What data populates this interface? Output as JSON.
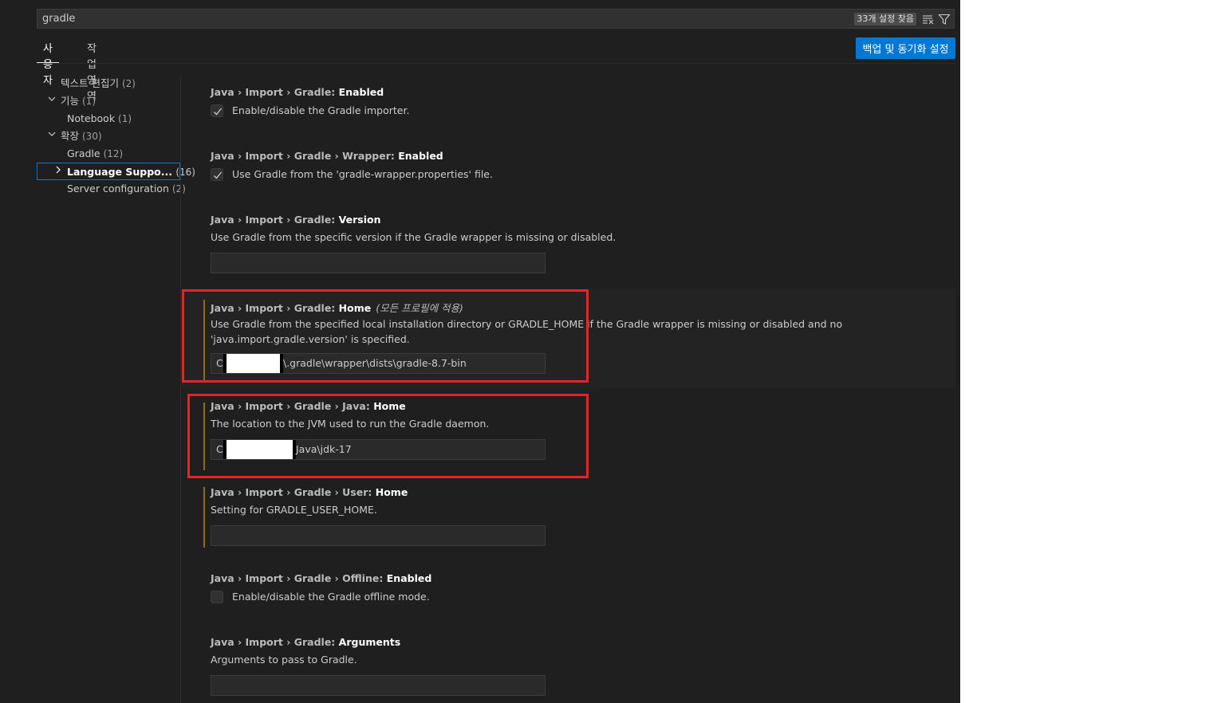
{
  "search": {
    "value": "gradle",
    "result_count": "33개 설정 찾음"
  },
  "tabs": [
    {
      "label": "사용자"
    },
    {
      "label": "작업 영역"
    }
  ],
  "sync_button": "백업 및 동기화 설정",
  "toc": [
    {
      "label": "텍스트 편집기",
      "count": "(2)"
    },
    {
      "label": "기능",
      "count": "(1)"
    },
    {
      "label": "Notebook",
      "count": "(1)"
    },
    {
      "label": "확장",
      "count": "(30)"
    },
    {
      "label": "Gradle",
      "count": "(12)"
    },
    {
      "label": "Language Suppo...",
      "count": "(16)"
    },
    {
      "label": "Server configuration",
      "count": "(2)"
    }
  ],
  "settings": [
    {
      "path": "Java › Import › Gradle: ",
      "name": "Enabled",
      "description": "Enable/disable the Gradle importer.",
      "checked": true
    },
    {
      "path": "Java › Import › Gradle › Wrapper: ",
      "name": "Enabled",
      "description": "Use Gradle from the 'gradle-wrapper.properties' file.",
      "checked": true
    },
    {
      "path": "Java › Import › Gradle: ",
      "name": "Version",
      "description": "Use Gradle from the specific version if the Gradle wrapper is missing or disabled.",
      "value": ""
    },
    {
      "path": "Java › Import › Gradle: ",
      "name": "Home",
      "scope": "(모든 프로필에 적용)",
      "description": "Use Gradle from the specified local installation directory or GRADLE_HOME if the Gradle wrapper is missing or disabled and no 'java.import.gradle.version' is specified.",
      "value_prefix": "C",
      "value_suffix": "\\.gradle\\wrapper\\dists\\gradle-8.7-bin"
    },
    {
      "path": "Java › Import › Gradle › Java: ",
      "name": "Home",
      "description": "The location to the JVM used to run the Gradle daemon.",
      "value_prefix": "C",
      "value_suffix": "Java\\jdk-17"
    },
    {
      "path": "Java › Import › Gradle › User: ",
      "name": "Home",
      "description": "Setting for GRADLE_USER_HOME.",
      "value": ""
    },
    {
      "path": "Java › Import › Gradle › Offline: ",
      "name": "Enabled",
      "description": "Enable/disable the Gradle offline mode.",
      "checked": false
    },
    {
      "path": "Java › Import › Gradle: ",
      "name": "Arguments",
      "description": "Arguments to pass to Gradle.",
      "value": ""
    }
  ],
  "icons": {
    "clear_filter": "clear-filter-icon",
    "filter": "filter-icon",
    "chevron_down": "chevron-down-icon",
    "chevron_right": "chevron-right-icon",
    "check": "check-icon"
  },
  "colors": {
    "background": "#1f1f1f",
    "accent": "#0078d4",
    "highlight": "#e52328",
    "modified": "#8a6d1f"
  }
}
